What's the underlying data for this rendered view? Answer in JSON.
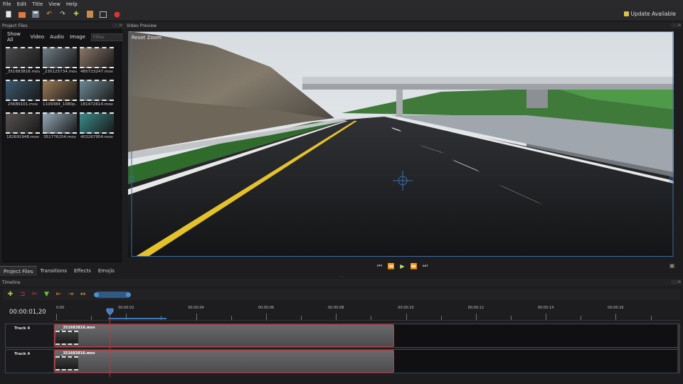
{
  "menu": [
    "File",
    "Edit",
    "Title",
    "View",
    "Help"
  ],
  "toolbar": {
    "icons": [
      "new-file-icon",
      "open-folder-icon",
      "save-icon",
      "undo-icon",
      "redo-icon",
      "add-icon",
      "import-icon",
      "fullscreen-icon",
      "record-icon"
    ],
    "update_label": "Update Available"
  },
  "panels": {
    "project_files_title": "Project Files",
    "video_preview_title": "Video Preview",
    "timeline_title": "Timeline",
    "panel_controls": "▢▢⊠"
  },
  "project_files": {
    "filters": [
      "Show All",
      "Video",
      "Audio",
      "Image"
    ],
    "filter_placeholder": "Filter",
    "files": [
      {
        "name": "_351683816.mov",
        "color": "#4a4a4c"
      },
      {
        "name": "_230125734.mov",
        "color": "#6f7d86"
      },
      {
        "name": "485723247.mov",
        "color": "#8a7669"
      },
      {
        "name": "25689101.mov",
        "color": "#3b5a70"
      },
      {
        "name": "1109384_1080p...",
        "color": "#9b7a55"
      },
      {
        "name": "181472614.mov",
        "color": "#6f8a95"
      },
      {
        "name": "182691948.mov",
        "color": "#585252"
      },
      {
        "name": "351776254.mov",
        "color": "#93a7b6"
      },
      {
        "name": "403267954.mov",
        "color": "#3b8a8a"
      }
    ]
  },
  "bottom_tabs": [
    "Project Files",
    "Transitions",
    "Effects",
    "Emojis"
  ],
  "preview": {
    "reset_zoom": "Reset Zoom"
  },
  "timeline": {
    "timecode": "00:00:01,20",
    "ruler_labels": [
      "0:00",
      "00:00:02",
      "00:00:04",
      "00:00:06",
      "00:00:08",
      "00:00:10",
      "00:00:12",
      "00:00:14",
      "00:00:16"
    ],
    "tracks": [
      {
        "label": "Track 4",
        "clip_name": "_351683816.mov"
      },
      {
        "label": "Track 4",
        "clip_name": "_351683816.mov"
      }
    ]
  }
}
